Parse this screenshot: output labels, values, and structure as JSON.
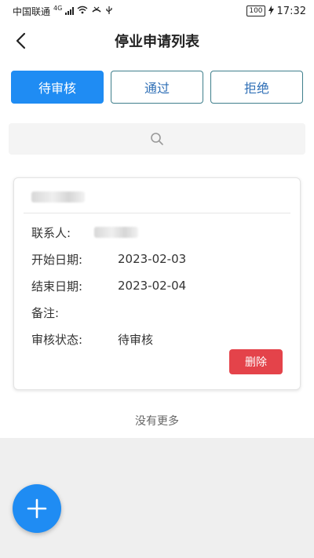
{
  "status_bar": {
    "carrier": "中国联通",
    "network": "4G",
    "time": "17:32",
    "battery": "100"
  },
  "header": {
    "title": "停业申请列表"
  },
  "tabs": [
    {
      "label": "待审核",
      "active": true
    },
    {
      "label": "通过",
      "active": false
    },
    {
      "label": "拒绝",
      "active": false
    }
  ],
  "search": {
    "placeholder": ""
  },
  "card": {
    "contact_label": "联系人:",
    "start_date_label": "开始日期:",
    "start_date": "2023-02-03",
    "end_date_label": "结束日期:",
    "end_date": "2023-02-04",
    "note_label": "备注:",
    "note": "",
    "status_label": "审核状态:",
    "status": "待审核",
    "delete_label": "删除"
  },
  "list_footer": "没有更多",
  "colors": {
    "primary": "#1f8cf3",
    "danger": "#e4434a",
    "tab_border": "#3f7f8c"
  },
  "icons": {
    "back": "chevron-left-icon",
    "search": "search-icon",
    "add": "plus-icon"
  }
}
